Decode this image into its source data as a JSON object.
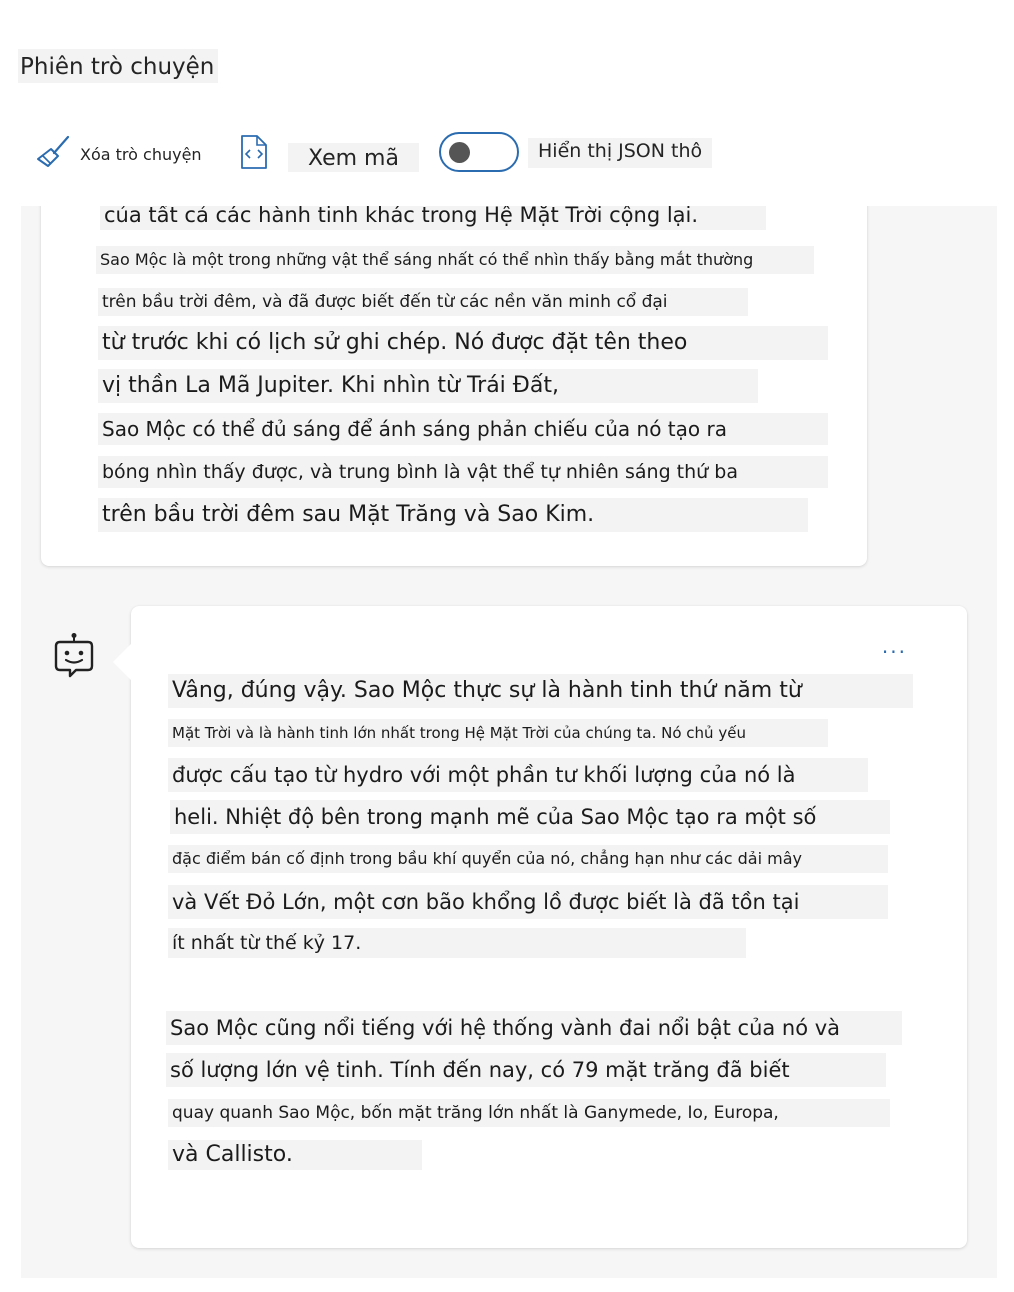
{
  "session": {
    "title": "Phiên trò chuyện"
  },
  "toolbar": {
    "clear_label": "Xóa trò chuyện",
    "code_label": "Xem mã",
    "json_label": "Hiển thị JSON thô",
    "json_toggle_on": false
  },
  "user_message": {
    "lines": [
      "của tất cả các hành tinh khác trong Hệ Mặt Trời cộng lại.",
      "Sao Mộc là một trong những vật thể sáng nhất có thể nhìn thấy bằng mắt thường",
      "trên bầu trời đêm, và đã được biết đến từ các nền văn minh cổ đại",
      "từ trước khi có lịch sử ghi chép. Nó được đặt tên theo",
      "vị thần La Mã Jupiter. Khi nhìn từ Trái Đất,",
      "Sao Mộc có thể đủ sáng để ánh sáng phản chiếu của nó tạo ra",
      "bóng nhìn thấy được, và trung bình là vật thể tự nhiên sáng thứ ba",
      "trên bầu trời đêm sau Mặt Trăng và Sao Kim."
    ]
  },
  "bot_message": {
    "more_label": "...",
    "lines": [
      "Vâng, đúng vậy. Sao Mộc thực sự là hành tinh thứ năm từ",
      "Mặt Trời và là hành tinh lớn nhất trong Hệ Mặt Trời của chúng ta. Nó chủ yếu",
      "được cấu tạo từ hydro với một phần tư khối lượng của nó là",
      "heli. Nhiệt độ bên trong mạnh mẽ của Sao Mộc tạo ra một số",
      "đặc điểm bán cố định trong bầu khí quyển của nó, chẳng hạn như các dải mây",
      "và Vết Đỏ Lớn, một cơn bão khổng lồ được biết là đã tồn tại",
      "ít nhất từ thế kỷ 17.",
      "Sao Mộc cũng nổi tiếng với hệ thống vành đai nổi bật của nó và",
      "số lượng lớn vệ tinh. Tính đến nay, có 79 mặt trăng đã biết",
      "quay quanh Sao Mộc, bốn mặt trăng lớn nhất là Ganymede, Io, Europa,",
      "và Callisto."
    ]
  },
  "colors": {
    "accent": "#2b6cb0",
    "text_highlight": "#f3f3f3",
    "chat_background": "#f6f6f6"
  }
}
